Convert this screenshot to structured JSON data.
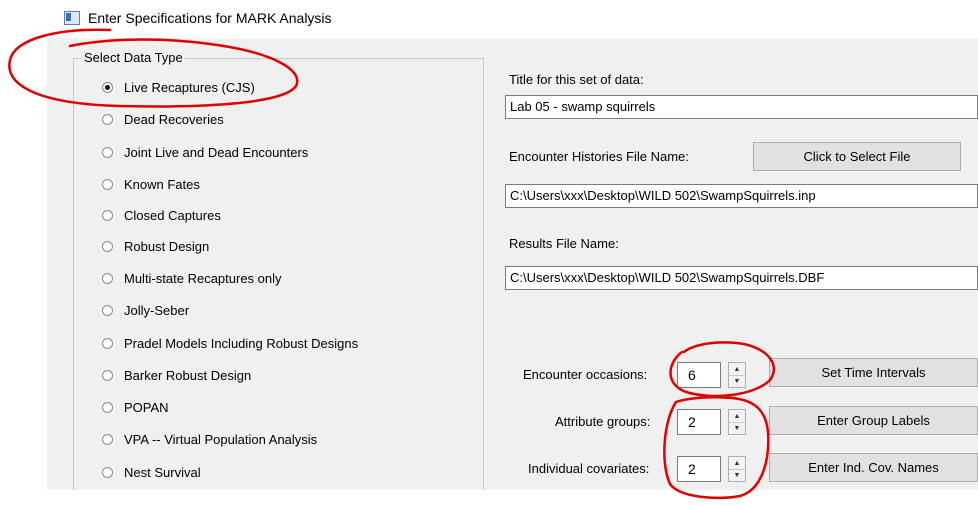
{
  "window": {
    "title": "Enter Specifications for MARK Analysis"
  },
  "data_type": {
    "legend": "Select Data Type",
    "options": [
      {
        "label": "Live Recaptures (CJS)",
        "selected": true
      },
      {
        "label": "Dead Recoveries",
        "selected": false
      },
      {
        "label": "Joint Live and Dead Encounters",
        "selected": false
      },
      {
        "label": "Known Fates",
        "selected": false
      },
      {
        "label": "Closed Captures",
        "selected": false
      },
      {
        "label": "Robust Design",
        "selected": false
      },
      {
        "label": "Multi-state Recaptures only",
        "selected": false
      },
      {
        "label": "Jolly-Seber",
        "selected": false
      },
      {
        "label": "Pradel Models Including Robust Designs",
        "selected": false
      },
      {
        "label": "Barker Robust Design",
        "selected": false
      },
      {
        "label": "POPAN",
        "selected": false
      },
      {
        "label": "VPA -- Virtual Population Analysis",
        "selected": false
      },
      {
        "label": "Nest Survival",
        "selected": false
      }
    ]
  },
  "form": {
    "title_label": "Title for this set of data:",
    "title_value": "Lab 05 - swamp squirrels",
    "enc_hist_label": "Encounter Histories File Name:",
    "select_file_button": "Click to Select File",
    "enc_hist_value": "C:\\Users\\xxx\\Desktop\\WILD 502\\SwampSquirrels.inp",
    "results_label": "Results File Name:",
    "results_value": "C:\\Users\\xxx\\Desktop\\WILD 502\\SwampSquirrels.DBF",
    "occasions_label": "Encounter occasions:",
    "occasions_value": "6",
    "time_intervals_button": "Set Time Intervals",
    "groups_label": "Attribute groups:",
    "groups_value": "2",
    "group_labels_button": "Enter Group Labels",
    "covariates_label": "Individual covariates:",
    "covariates_value": "2",
    "cov_names_button": "Enter Ind. Cov. Names"
  },
  "colors": {
    "annotation": "#e00000",
    "dialog_bg": "#f0f0f0"
  }
}
